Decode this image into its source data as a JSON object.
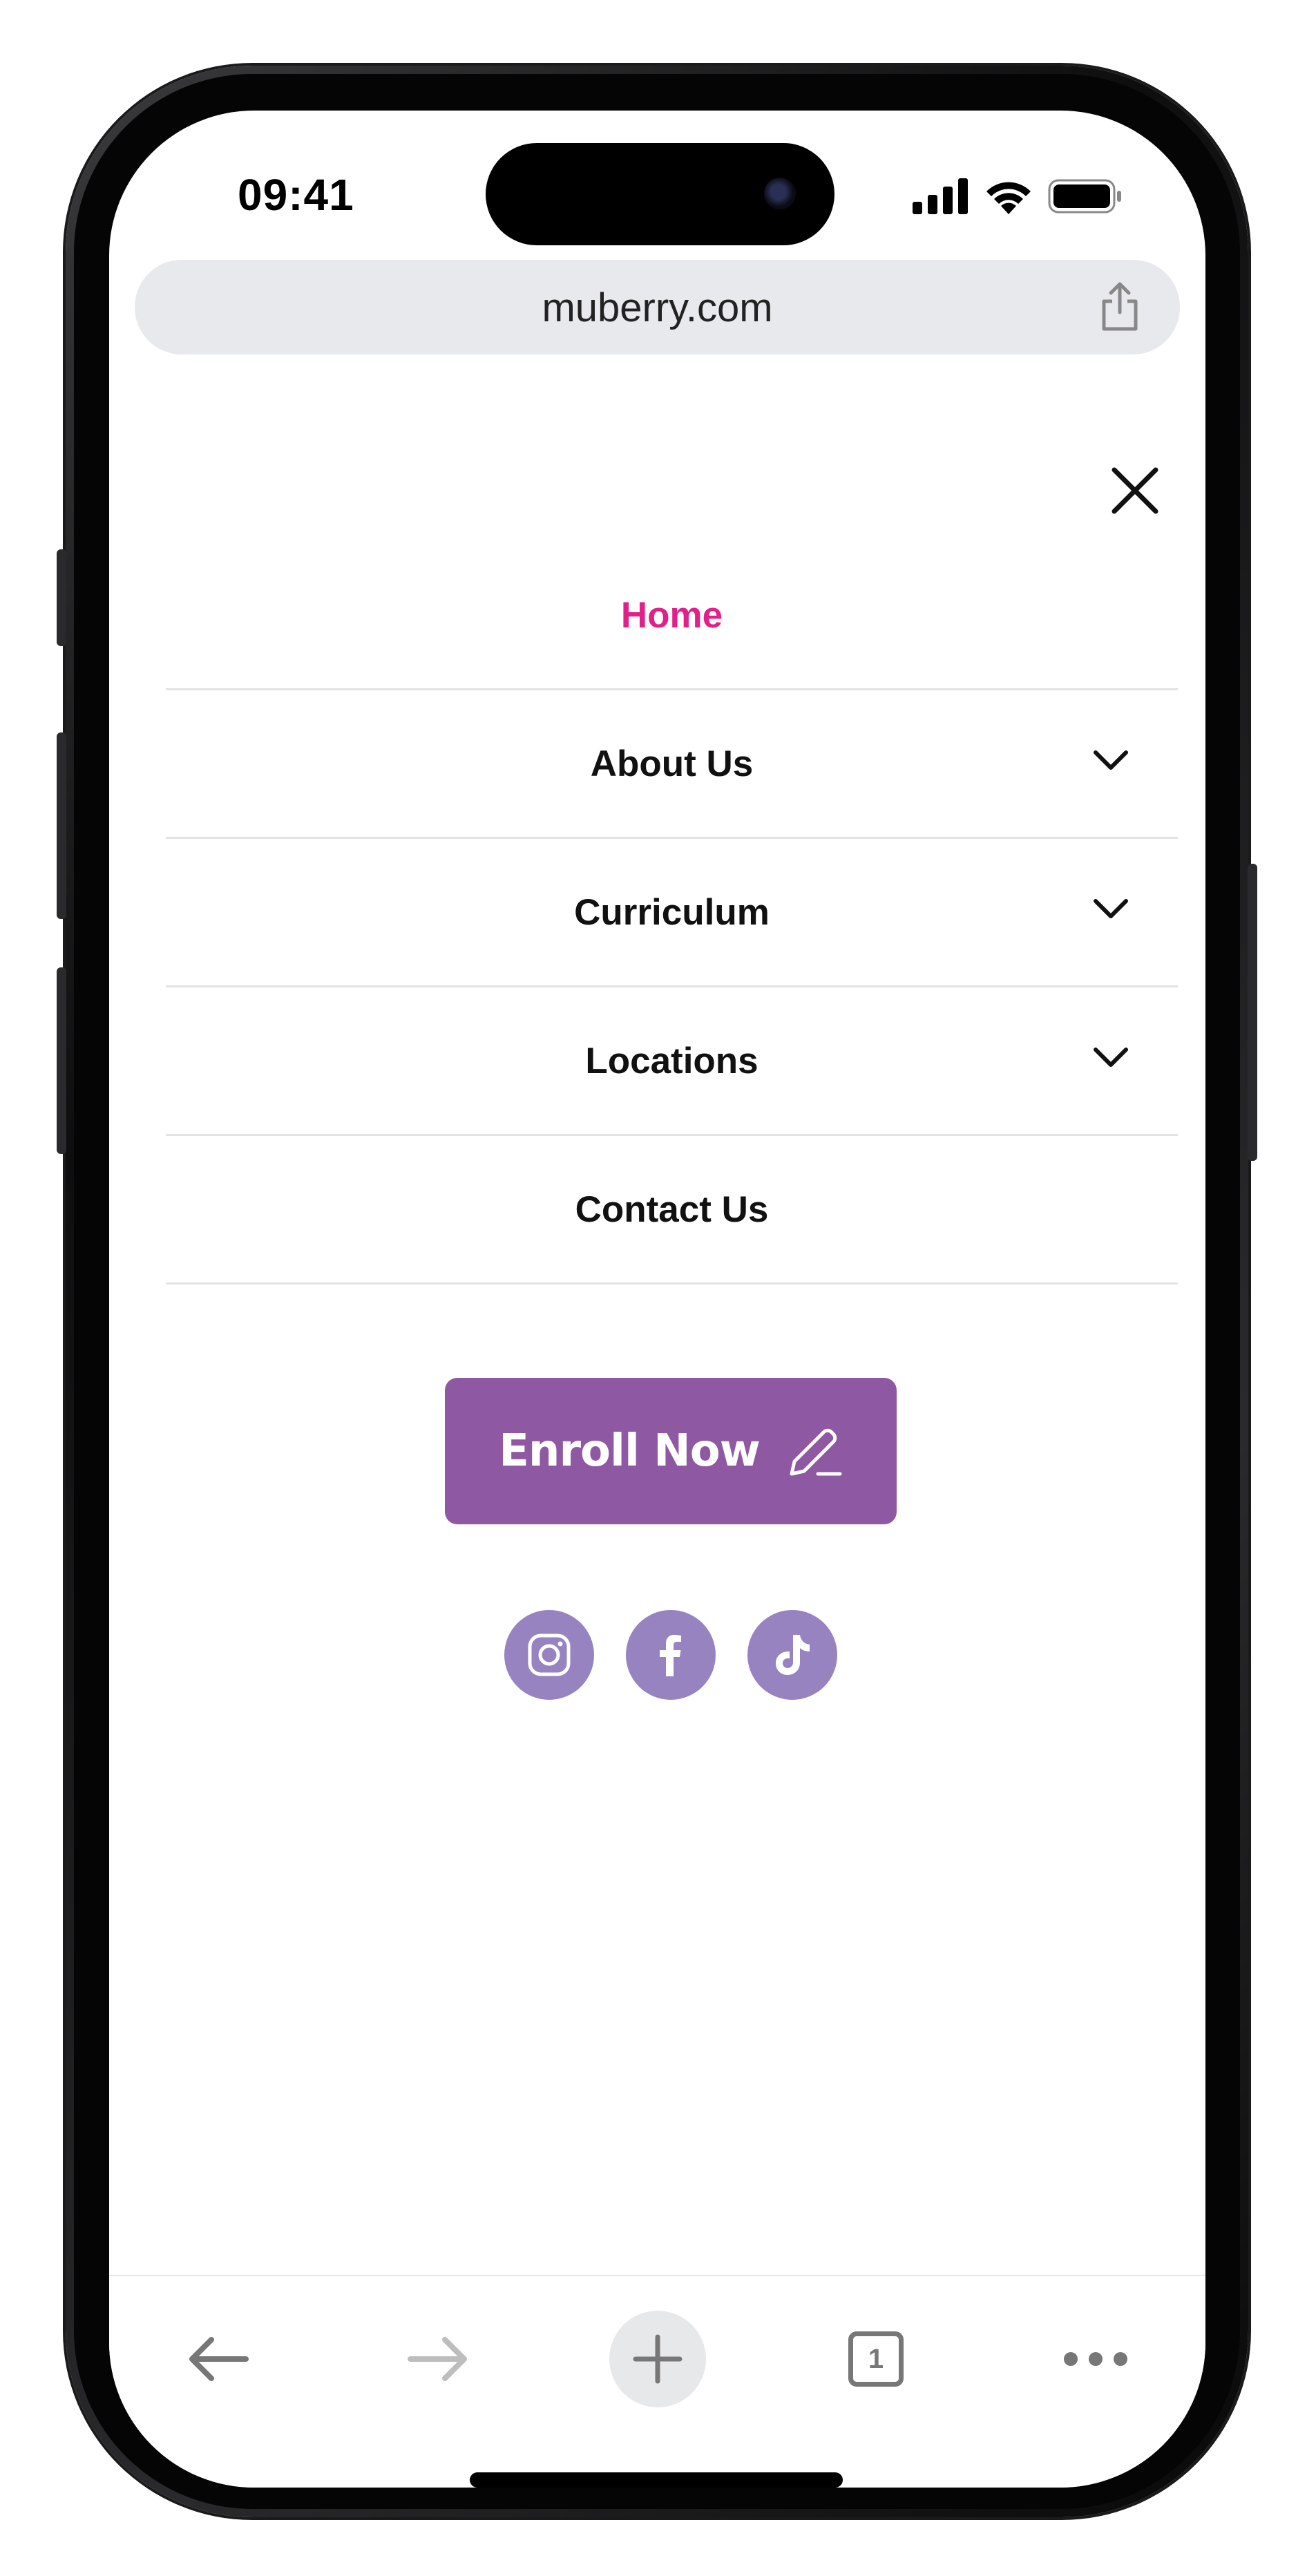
{
  "status": {
    "time": "09:41"
  },
  "browser": {
    "url": "muberry.com",
    "tab_count": "1"
  },
  "menu": {
    "items": [
      {
        "label": "Home",
        "active": true,
        "has_submenu": false
      },
      {
        "label": "About Us",
        "active": false,
        "has_submenu": true
      },
      {
        "label": "Curriculum",
        "active": false,
        "has_submenu": true
      },
      {
        "label": "Locations",
        "active": false,
        "has_submenu": true
      },
      {
        "label": "Contact Us",
        "active": false,
        "has_submenu": false
      }
    ]
  },
  "cta": {
    "label": "Enroll Now",
    "icon": "pencil-icon"
  },
  "socials": [
    "instagram-icon",
    "facebook-icon",
    "tiktok-icon"
  ],
  "colors": {
    "accent": "#e0218a",
    "button": "#8e59a2",
    "social": "#9783c0"
  }
}
